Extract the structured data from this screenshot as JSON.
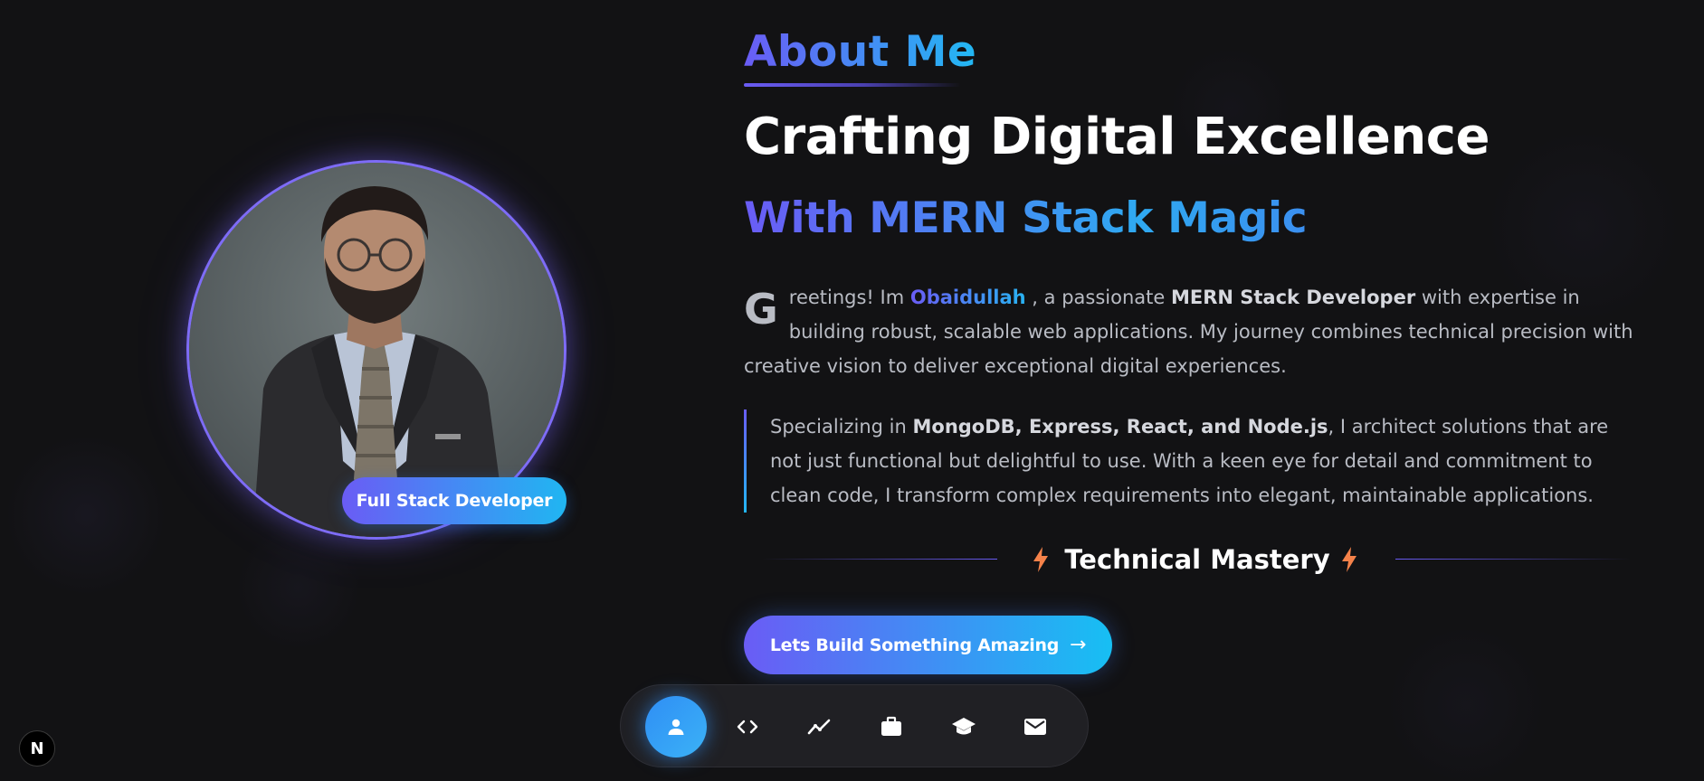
{
  "profile": {
    "role_badge": "Full Stack Developer"
  },
  "about": {
    "section_label": "About Me",
    "headline": "Crafting Digital Excellence",
    "subheadline": "With MERN Stack Magic",
    "intro": {
      "drop_cap": "G",
      "text_1": "reetings! Im ",
      "name": "Obaidullah",
      "text_2": " , a passionate ",
      "role": "MERN Stack Developer",
      "text_3": " with expertise in building robust, scalable web applications. My journey combines technical precision with creative vision to deliver exceptional digital experiences."
    },
    "quote": {
      "text_1": "Specializing in ",
      "stack": "MongoDB, Express, React, and Node.js",
      "text_2": ", I architect solutions that are not just functional but delightful to use. With a keen eye for detail and commitment to clean code, I transform complex requirements into elegant, maintainable applications."
    },
    "mastery_title": "Technical Mastery",
    "cta_label": "Lets Build Something Amazing",
    "cta_arrow": "→"
  },
  "dock": {
    "items": [
      {
        "icon": "user-icon",
        "active": true
      },
      {
        "icon": "code-icon",
        "active": false
      },
      {
        "icon": "chart-line-icon",
        "active": false
      },
      {
        "icon": "briefcase-icon",
        "active": false
      },
      {
        "icon": "graduation-cap-icon",
        "active": false
      },
      {
        "icon": "mail-icon",
        "active": false
      }
    ]
  },
  "next_badge": "N",
  "colors": {
    "background": "#121214",
    "accent_start": "#6a5cf5",
    "accent_end": "#22b8f3",
    "bolt": "#f5824a"
  }
}
